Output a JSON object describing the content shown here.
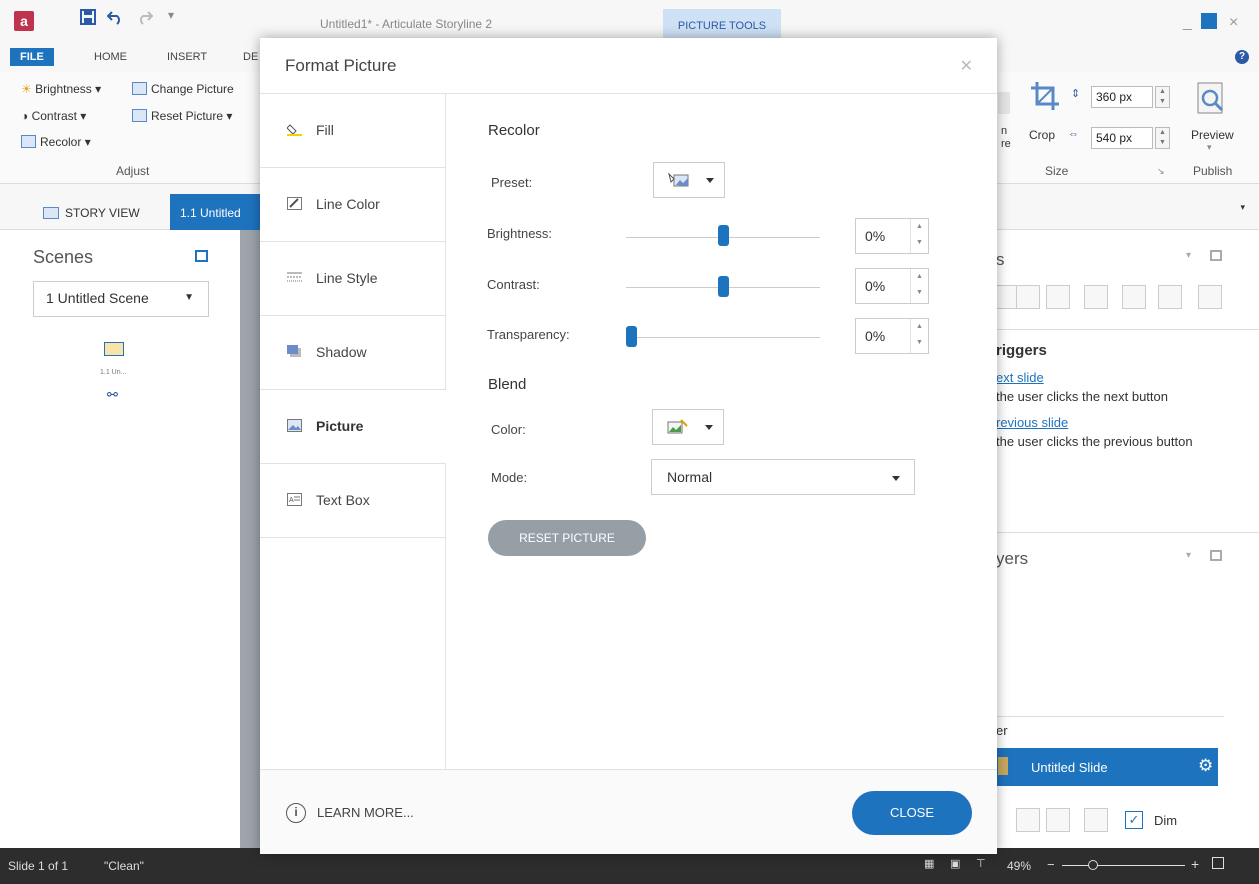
{
  "window": {
    "title": "Untitled1* - Articulate Storyline 2",
    "contextual_tab": "PICTURE TOOLS",
    "minimize_glyph": "_",
    "restore_glyph": "□",
    "close_glyph": "×"
  },
  "ribbon_tabs": [
    "FILE",
    "HOME",
    "INSERT",
    "DE"
  ],
  "ribbon": {
    "adjust": {
      "brightness": "Brightness",
      "change_picture": "Change Picture",
      "contrast": "Contrast",
      "reset_picture": "Reset Picture",
      "recolor": "Recolor",
      "group_label": "Adjust"
    },
    "size": {
      "partial_label_1": "n",
      "partial_label_2": "re",
      "crop": "Crop",
      "height": "360 px",
      "width": "540 px",
      "group_label": "Size"
    },
    "publish": {
      "preview": "Preview",
      "group_label": "Publish"
    }
  },
  "view_tabs": {
    "story_view": "STORY VIEW",
    "active": "1.1 Untitled"
  },
  "scenes_panel": {
    "title": "Scenes",
    "selected_scene": "1 Untitled Scene",
    "thumb_label": "1.1 Un..."
  },
  "right_panel": {
    "triggers_title_partial": "s",
    "triggers_heading": "riggers",
    "trigger_1_link": "ext slide",
    "trigger_1_text": "the user clicks the next button",
    "trigger_2_link": "revious slide",
    "trigger_2_text": "the user clicks the previous button",
    "layers_title_partial": "yers",
    "layer_header_partial": "er",
    "layer_name": "Untitled Slide",
    "dim_label": "Dim"
  },
  "status_bar": {
    "slide_info": "Slide 1 of 1",
    "theme": "\"Clean\"",
    "zoom": "49%"
  },
  "dialog": {
    "title": "Format Picture",
    "nav": [
      {
        "label": "Fill",
        "icon": "fill-bucket-icon"
      },
      {
        "label": "Line Color",
        "icon": "pencil-icon"
      },
      {
        "label": "Line Style",
        "icon": "line-style-icon"
      },
      {
        "label": "Shadow",
        "icon": "shadow-icon"
      },
      {
        "label": "Picture",
        "icon": "picture-icon"
      },
      {
        "label": "Text Box",
        "icon": "text-box-icon"
      }
    ],
    "active_nav": "Picture",
    "recolor": {
      "section": "Recolor",
      "preset_label": "Preset:",
      "brightness_label": "Brightness:",
      "brightness_value": "0%",
      "brightness_level": 0.5,
      "contrast_label": "Contrast:",
      "contrast_value": "0%",
      "contrast_level": 0.5,
      "transparency_label": "Transparency:",
      "transparency_value": "0%",
      "transparency_level": 0
    },
    "blend": {
      "section": "Blend",
      "color_label": "Color:",
      "mode_label": "Mode:",
      "mode_value": "Normal"
    },
    "reset_button": "RESET PICTURE",
    "learn_more": "LEARN MORE...",
    "close_button": "CLOSE",
    "accent_color": "#1e73be"
  }
}
